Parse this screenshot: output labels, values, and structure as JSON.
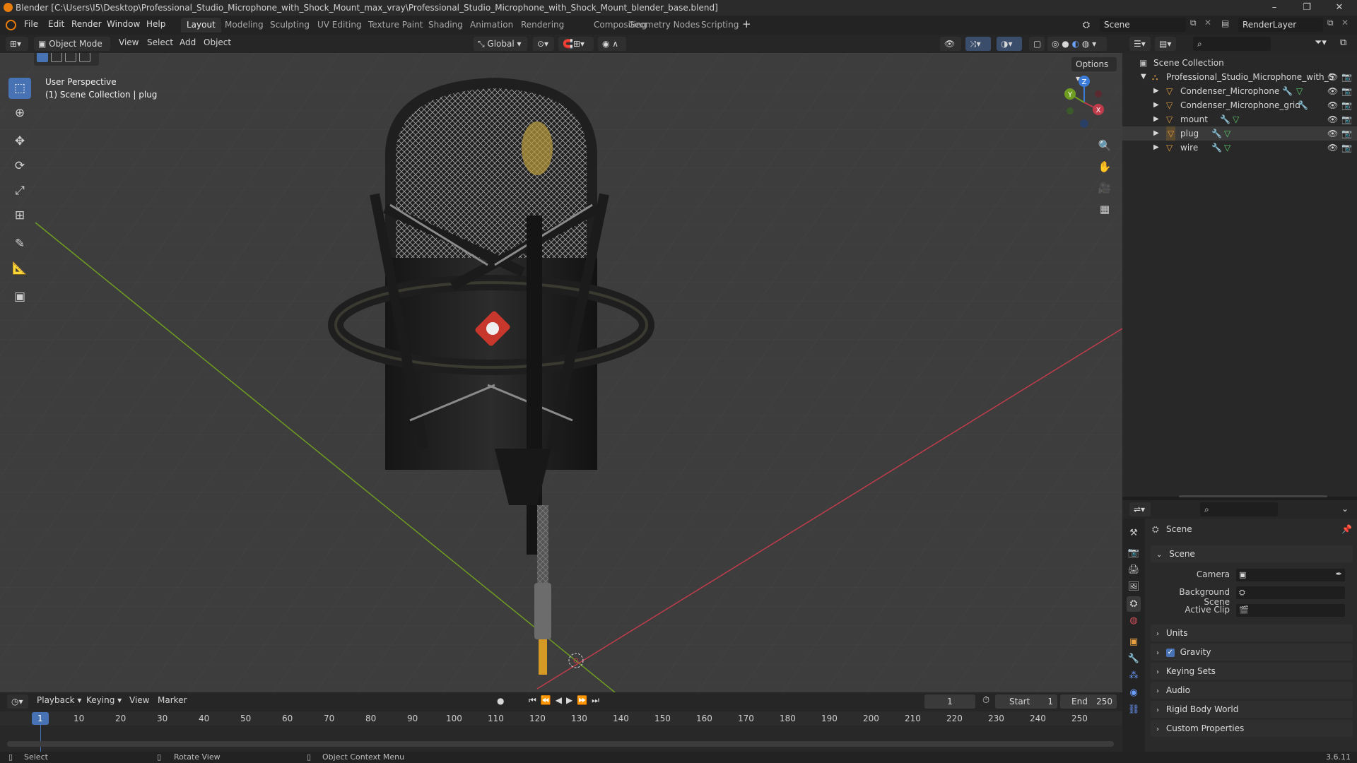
{
  "window": {
    "title": "Blender [C:\\Users\\I5\\Desktop\\Professional_Studio_Microphone_with_Shock_Mount_max_vray\\Professional_Studio_Microphone_with_Shock_Mount_blender_base.blend]",
    "minimize": "–",
    "maximize": "❐",
    "close": "✕"
  },
  "menu": [
    "File",
    "Edit",
    "Render",
    "Window",
    "Help"
  ],
  "workspaces": [
    "Layout",
    "Modeling",
    "Sculpting",
    "UV Editing",
    "Texture Paint",
    "Shading",
    "Animation",
    "Rendering",
    "Compositing",
    "Geometry Nodes",
    "Scripting"
  ],
  "active_workspace": "Layout",
  "scene_selector": "Scene",
  "renderlayer_selector": "RenderLayer",
  "viewport_header": {
    "mode": "Object Mode",
    "menus": [
      "View",
      "Select",
      "Add",
      "Object"
    ],
    "transform_orientation": "Global",
    "options": "Options"
  },
  "viewport": {
    "perspective": "User Perspective",
    "collection_info": "(1) Scene Collection | plug",
    "gizmo_axes": [
      "Z",
      "X",
      "Y"
    ]
  },
  "outliner": {
    "root": "Scene Collection",
    "collection": "Professional_Studio_Microphone_with_S",
    "objects": [
      "Condenser_Microphone",
      "Condenser_Microphone_grid",
      "mount",
      "plug",
      "wire"
    ]
  },
  "properties": {
    "context_title": "Scene",
    "panel_title": "Scene",
    "fields": {
      "camera_label": "Camera",
      "background_scene_label": "Background Scene",
      "active_clip_label": "Active Clip"
    },
    "sections": [
      "Units",
      "Gravity",
      "Keying Sets",
      "Audio",
      "Rigid Body World",
      "Custom Properties"
    ],
    "gravity_checked": true
  },
  "timeline": {
    "menus": [
      "Playback",
      "Keying",
      "View",
      "Marker"
    ],
    "current_frame": "1",
    "start_label": "Start",
    "start_value": "1",
    "end_label": "End",
    "end_value": "250",
    "frame_ticks": [
      "1",
      "10",
      "20",
      "30",
      "40",
      "50",
      "60",
      "70",
      "80",
      "90",
      "100",
      "110",
      "120",
      "130",
      "140",
      "150",
      "160",
      "170",
      "180",
      "190",
      "200",
      "210",
      "220",
      "230",
      "240",
      "250"
    ]
  },
  "statusbar": {
    "hints": [
      "Select",
      "Rotate View",
      "Object Context Menu"
    ],
    "version": "3.6.11"
  },
  "colors": {
    "accent": "#4772b3",
    "x_axis": "#c03c4b",
    "y_axis": "#6f9d21",
    "z_axis": "#3c7bd8",
    "object_icon": "#e8a040"
  }
}
